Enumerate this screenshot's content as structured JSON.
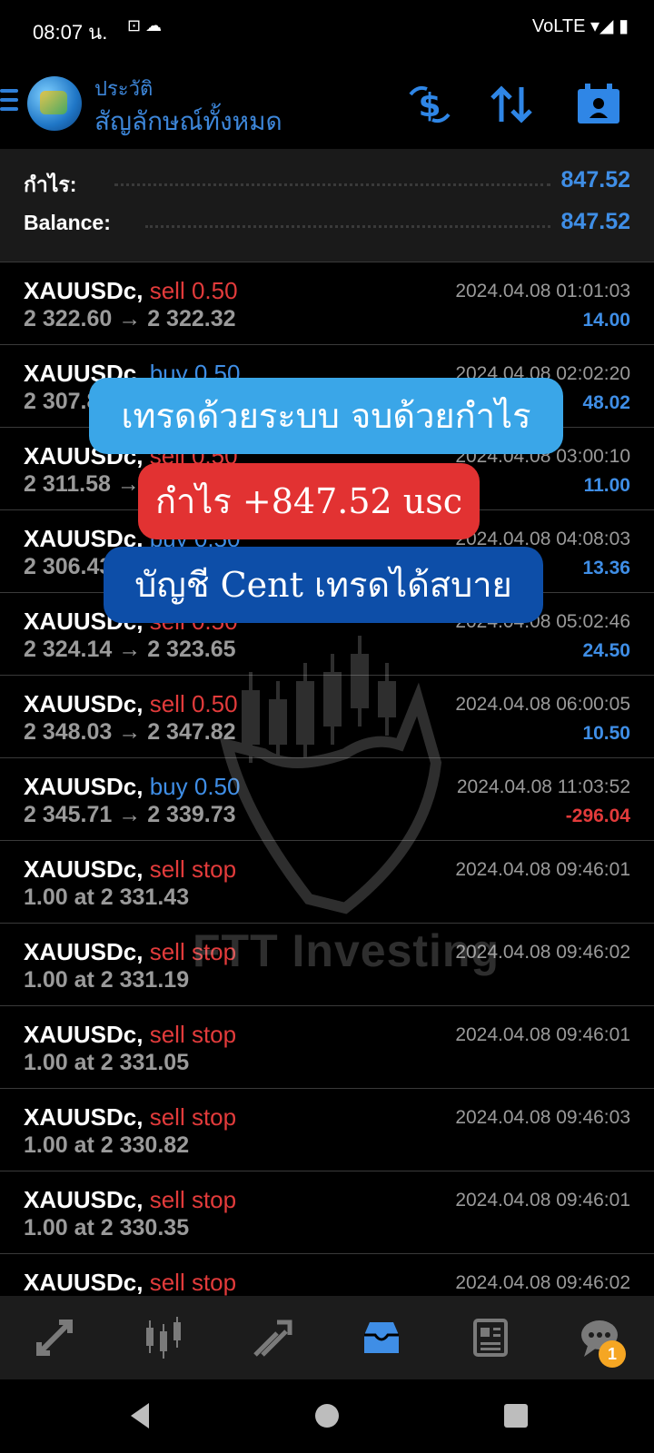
{
  "status_bar": {
    "time": "08:07 น.",
    "notif": "⊡ ☁",
    "right": "VoLTE ▾◢ ▮"
  },
  "app_bar": {
    "subtitle": "ประวัติ",
    "title": "สัญลักษณ์ทั้งหมด"
  },
  "summary": {
    "profit_label": "กำไร:",
    "profit_value": "847.52",
    "balance_label": "Balance:",
    "balance_value": "847.52"
  },
  "trades": [
    {
      "symbol": "XAUUSDc,",
      "type": "sell 0.50",
      "side": "sell",
      "price": "2 322.60 → 2 322.32",
      "time": "2024.04.08 01:01:03",
      "pl": "14.00",
      "pl_sign": "pos"
    },
    {
      "symbol": "XAUUSDc,",
      "type": "buy 0.50",
      "side": "buy",
      "price": "2 307.8",
      "time": "2024.04.08 02:02:20",
      "pl": "48.02",
      "pl_sign": "pos"
    },
    {
      "symbol": "XAUUSDc,",
      "type": "sell 0.50",
      "side": "sell",
      "price": "2 311.58 →",
      "time": "2024.04.08 03:00:10",
      "pl": "11.00",
      "pl_sign": "pos"
    },
    {
      "symbol": "XAUUSDc,",
      "type": "buy 0.50",
      "side": "buy",
      "price": "2 306.43",
      "time": "2024.04.08 04:08:03",
      "pl": "13.36",
      "pl_sign": "pos"
    },
    {
      "symbol": "XAUUSDc,",
      "type": "sell 0.50",
      "side": "sell",
      "price": "2 324.14 → 2 323.65",
      "time": "2024.04.08 05:02:46",
      "pl": "24.50",
      "pl_sign": "pos"
    },
    {
      "symbol": "XAUUSDc,",
      "type": "sell 0.50",
      "side": "sell",
      "price": "2 348.03 → 2 347.82",
      "time": "2024.04.08 06:00:05",
      "pl": "10.50",
      "pl_sign": "pos"
    },
    {
      "symbol": "XAUUSDc,",
      "type": "buy 0.50",
      "side": "buy",
      "price": "2 345.71 → 2 339.73",
      "time": "2024.04.08 11:03:52",
      "pl": "-296.04",
      "pl_sign": "neg"
    },
    {
      "symbol": "XAUUSDc,",
      "type": "sell stop",
      "side": "sell",
      "price": "1.00 at 2 331.43",
      "time": "2024.04.08 09:46:01",
      "pl": "",
      "pl_sign": "pos"
    },
    {
      "symbol": "XAUUSDc,",
      "type": "sell stop",
      "side": "sell",
      "price": "1.00 at 2 331.19",
      "time": "2024.04.08 09:46:02",
      "pl": "",
      "pl_sign": "pos"
    },
    {
      "symbol": "XAUUSDc,",
      "type": "sell stop",
      "side": "sell",
      "price": "1.00 at 2 331.05",
      "time": "2024.04.08 09:46:01",
      "pl": "",
      "pl_sign": "pos"
    },
    {
      "symbol": "XAUUSDc,",
      "type": "sell stop",
      "side": "sell",
      "price": "1.00 at 2 330.82",
      "time": "2024.04.08 09:46:03",
      "pl": "",
      "pl_sign": "pos"
    },
    {
      "symbol": "XAUUSDc,",
      "type": "sell stop",
      "side": "sell",
      "price": "1.00 at 2 330.35",
      "time": "2024.04.08 09:46:01",
      "pl": "",
      "pl_sign": "pos"
    },
    {
      "symbol": "XAUUSDc,",
      "type": "sell stop",
      "side": "sell",
      "price": "",
      "time": "2024.04.08 09:46:02",
      "pl": "",
      "pl_sign": "pos"
    }
  ],
  "promo": {
    "line1": "เทรดด้วยระบบ จบด้วยกำไร",
    "line2": "กำไร +847.52 usc",
    "line3": "บัญชี Cent เทรดได้สบาย"
  },
  "watermark": {
    "text": "FTT Investing"
  },
  "bottom_nav": {
    "badge": "1"
  },
  "colors": {
    "accent": "#3f8ee6",
    "sell": "#e23b3b",
    "background": "#000000",
    "promo_blue": "#3aa6e8",
    "promo_red": "#e23232",
    "promo_navy": "#0d4ea8"
  }
}
